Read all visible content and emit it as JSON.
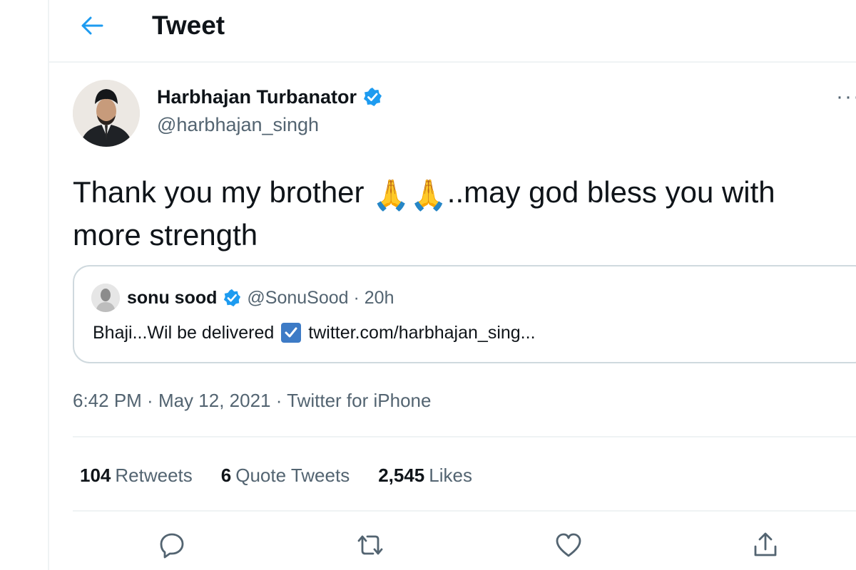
{
  "header": {
    "title": "Tweet",
    "back_icon": "arrow-left-icon"
  },
  "tweet": {
    "author_name": "Harbhajan Turbanator",
    "author_handle": "@harbhajan_singh",
    "verified_icon": "verified-badge-icon",
    "more_label": "···",
    "text_before": "Thank you my brother ",
    "emoji": "🙏🙏",
    "text_after": "..may god bless you with more strength",
    "timestamp": {
      "time": "6:42 PM",
      "date": "May 12, 2021",
      "source": "Twitter for iPhone",
      "sep": " · "
    }
  },
  "quote_tweet": {
    "name": "sonu sood",
    "handle": "@SonuSood",
    "time": "20h",
    "sep": " · ",
    "text": "Bhaji...Wil be delivered",
    "link": "twitter.com/harbhajan_sing..."
  },
  "stats": {
    "retweets_count": "104",
    "retweets_label": "Retweets",
    "quotes_count": "6",
    "quotes_label": "Quote Tweets",
    "likes_count": "2,545",
    "likes_label": "Likes"
  },
  "actions": [
    "reply-icon",
    "retweet-icon",
    "like-icon",
    "share-icon"
  ],
  "colors": {
    "accent": "#1d9bf0",
    "secondary_text": "#536471",
    "border": "#eff3f4"
  }
}
